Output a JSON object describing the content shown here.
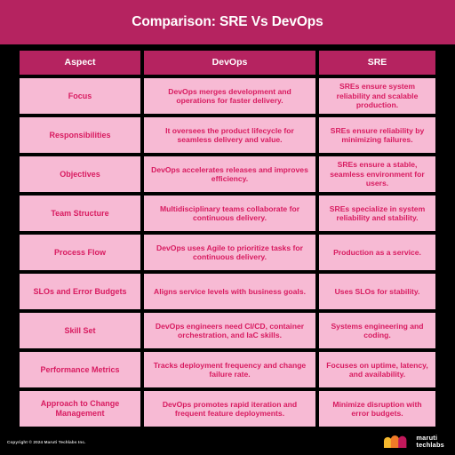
{
  "banner": {
    "title": "Comparison: SRE Vs DevOps",
    "background_color": "#B52360",
    "text_color": "#FFFFFF"
  },
  "table": {
    "header_background": "#B52360",
    "header_text_color": "#FFFFFF",
    "cell_background": "#F7BAD4",
    "cell_text_color": "#D81B60",
    "columns": [
      "Aspect",
      "DevOps",
      "SRE"
    ],
    "rows": [
      {
        "aspect": "Focus",
        "devops": "DevOps merges development and operations for faster delivery.",
        "sre": "SREs ensure system reliability and scalable production."
      },
      {
        "aspect": "Responsibilities",
        "devops": "It oversees the product lifecycle for seamless delivery and value.",
        "sre": "SREs ensure reliability by minimizing failures."
      },
      {
        "aspect": "Objectives",
        "devops": "DevOps accelerates releases and improves efficiency.",
        "sre": "SREs ensure a stable, seamless environment for users."
      },
      {
        "aspect": "Team Structure",
        "devops": "Multidisciplinary teams collaborate for continuous delivery.",
        "sre": "SREs specialize in system reliability and stability."
      },
      {
        "aspect": "Process Flow",
        "devops": "DevOps uses Agile to prioritize tasks for continuous delivery.",
        "sre": "Production as a service."
      },
      {
        "aspect": "SLOs and Error Budgets",
        "devops": "Aligns service levels with business goals.",
        "sre": "Uses SLOs for stability."
      },
      {
        "aspect": "Skill Set",
        "devops": "DevOps engineers need CI/CD, container orchestration, and IaC skills.",
        "sre": "Systems engineering and coding."
      },
      {
        "aspect": "Performance Metrics",
        "devops": "Tracks deployment frequency and change failure rate.",
        "sre": "Focuses on uptime, latency, and availability."
      },
      {
        "aspect": "Approach to Change Management",
        "devops": "DevOps promotes rapid iteration and frequent feature deployments.",
        "sre": "Minimize disruption with error budgets."
      }
    ]
  },
  "footer": {
    "copyright": "Copyright © 2024 Maruti Techlabs Inc.",
    "logo": {
      "name_line1": "maruti",
      "name_line2": "techlabs",
      "arch_colors": [
        "#F5B82E",
        "#F07B28",
        "#C2185B"
      ]
    }
  }
}
